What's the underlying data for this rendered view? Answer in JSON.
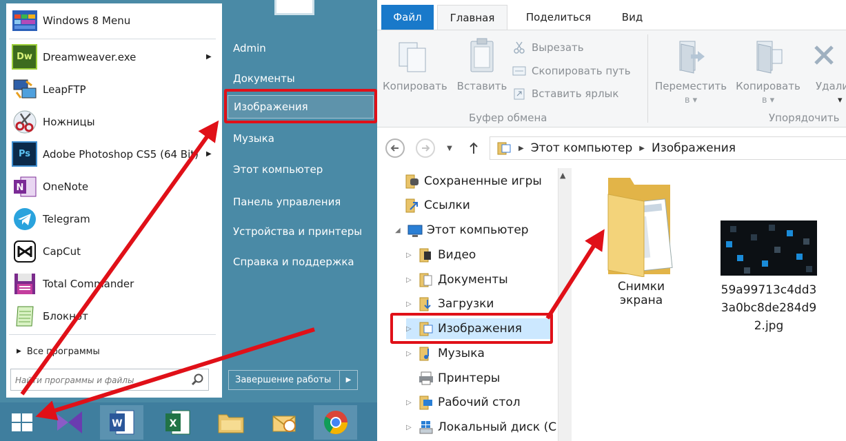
{
  "start_menu": {
    "programs": [
      {
        "label": "Windows 8 Menu",
        "icon": "windows8-menu-icon",
        "submenu": false
      },
      {
        "label": "Dreamweaver.exe",
        "icon": "dreamweaver-icon",
        "submenu": true
      },
      {
        "label": "LeapFTP",
        "icon": "leapftp-icon",
        "submenu": false
      },
      {
        "label": "Ножницы",
        "icon": "scissors-icon",
        "submenu": false
      },
      {
        "label": "Adobe Photoshop CS5 (64 Bit)",
        "icon": "photoshop-icon",
        "submenu": true
      },
      {
        "label": "OneNote",
        "icon": "onenote-icon",
        "submenu": false
      },
      {
        "label": "Telegram",
        "icon": "telegram-icon",
        "submenu": false
      },
      {
        "label": "CapCut",
        "icon": "capcut-icon",
        "submenu": false
      },
      {
        "label": "Total Commander",
        "icon": "total-commander-icon",
        "submenu": false
      },
      {
        "label": "Блокнот",
        "icon": "notepad-icon",
        "submenu": false
      }
    ],
    "all_programs_label": "Все программы",
    "search_placeholder": "Найти программы и файлы",
    "places": [
      {
        "label": "Admin"
      },
      {
        "label": "Документы"
      },
      {
        "label": "Изображения"
      },
      {
        "label": "Музыка"
      },
      {
        "label": "Этот компьютер"
      },
      {
        "label": "Панель управления"
      },
      {
        "label": "Устройства и принтеры"
      },
      {
        "label": "Справка и поддержка"
      }
    ],
    "shutdown_label": "Завершение работы"
  },
  "taskbar": {
    "buttons": [
      "start-icon",
      "visual-studio-icon",
      "word-icon",
      "excel-icon",
      "file-explorer-icon",
      "outlook-icon",
      "chrome-icon"
    ]
  },
  "explorer": {
    "tabs": {
      "file": "Файл",
      "home": "Главная",
      "share": "Поделиться",
      "view": "Вид"
    },
    "ribbon": {
      "copy": "Копировать",
      "paste": "Вставить",
      "cut": "Вырезать",
      "copy_path": "Скопировать путь",
      "paste_shortcut": "Вставить ярлык",
      "clipboard_group": "Буфер обмена",
      "move_to": "Переместить",
      "copy_to": "Копировать",
      "to_suffix": "в",
      "delete": "Удали",
      "organize_group": "Упорядочить"
    },
    "address": {
      "crumb1": "Этот компьютер",
      "crumb2": "Изображения"
    },
    "tree": [
      {
        "label": "Сохраненные игры",
        "icon": "saved-games-icon"
      },
      {
        "label": "Ссылки",
        "icon": "links-icon"
      },
      {
        "label": "Этот компьютер",
        "icon": "this-pc-icon"
      },
      {
        "label": "Видео",
        "icon": "videos-icon"
      },
      {
        "label": "Документы",
        "icon": "documents-icon"
      },
      {
        "label": "Загрузки",
        "icon": "downloads-icon"
      },
      {
        "label": "Изображения",
        "icon": "pictures-icon"
      },
      {
        "label": "Музыка",
        "icon": "music-icon"
      },
      {
        "label": "Принтеры",
        "icon": "printers-icon"
      },
      {
        "label": "Рабочий стол",
        "icon": "desktop-icon"
      },
      {
        "label": "Локальный диск (С"
      }
    ],
    "files": [
      {
        "label": "Снимки экрана",
        "icon": "folder-icon"
      },
      {
        "label_lines": [
          "59a99713c4dd3",
          "3a0bc8de284d9",
          "2.jpg"
        ],
        "icon": "image-thumbnail-icon"
      }
    ]
  },
  "colors": {
    "start_blue": "#4a8aa6",
    "taskbar_blue": "#3f7e9e",
    "file_tab_blue": "#1979ca",
    "highlight_red": "#e01018"
  }
}
